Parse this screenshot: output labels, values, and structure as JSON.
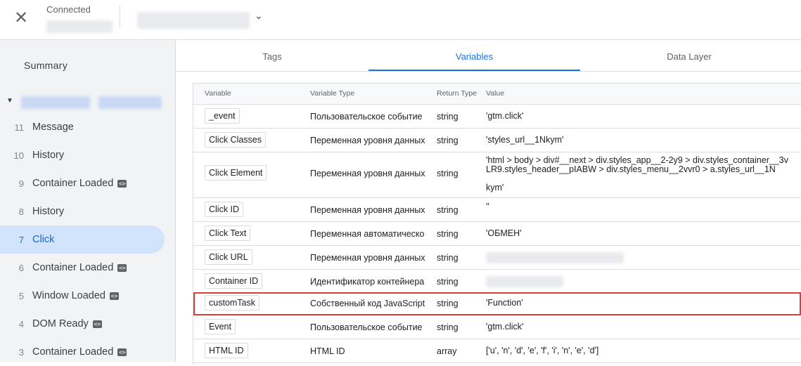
{
  "topbar": {
    "close_icon": "close-icon",
    "status_label": "Connected"
  },
  "sidebar": {
    "summary_label": "Summary",
    "events": [
      {
        "num": "11",
        "name": "Message",
        "tag": false,
        "active": false
      },
      {
        "num": "10",
        "name": "History",
        "tag": false,
        "active": false
      },
      {
        "num": "9",
        "name": "Container Loaded",
        "tag": true,
        "active": false
      },
      {
        "num": "8",
        "name": "History",
        "tag": false,
        "active": false
      },
      {
        "num": "7",
        "name": "Click",
        "tag": false,
        "active": true
      },
      {
        "num": "6",
        "name": "Container Loaded",
        "tag": true,
        "active": false
      },
      {
        "num": "5",
        "name": "Window Loaded",
        "tag": true,
        "active": false
      },
      {
        "num": "4",
        "name": "DOM Ready",
        "tag": true,
        "active": false
      },
      {
        "num": "3",
        "name": "Container Loaded",
        "tag": true,
        "active": false
      }
    ]
  },
  "tabs": [
    {
      "label": "Tags",
      "active": false
    },
    {
      "label": "Variables",
      "active": true
    },
    {
      "label": "Data Layer",
      "active": false
    }
  ],
  "table": {
    "headers": {
      "variable": "Variable",
      "variable_type": "Variable Type",
      "return_type": "Return Type",
      "value": "Value"
    },
    "rows": [
      {
        "variable": "_event",
        "type": "Пользовательское событие",
        "return": "string",
        "value": "'gtm.click'"
      },
      {
        "variable": "Click Classes",
        "type": "Переменная уровня данных",
        "return": "string",
        "value": "'styles_url__1Nkym'"
      },
      {
        "variable": "Click Element",
        "type": "Переменная уровня данных",
        "return": "string",
        "value": "'html > body > div#__next > div.styles_app__2-2y9 > div.styles_container__3vLR9.styles_header__pIABW > div.styles_menu__2vvr0 > a.styles_url__1N",
        "value2": "kym'"
      },
      {
        "variable": "Click ID",
        "type": "Переменная уровня данных",
        "return": "string",
        "value": "''"
      },
      {
        "variable": "Click Text",
        "type": "Переменная автоматическо",
        "return": "string",
        "value": "'ОБМЕН'"
      },
      {
        "variable": "Click URL",
        "type": "Переменная уровня данных",
        "return": "string",
        "value": ""
      },
      {
        "variable": "Container ID",
        "type": "Идентификатор контейнера",
        "return": "string",
        "value": ""
      },
      {
        "variable": "customTask",
        "type": "Собственный код JavaScript",
        "return": "string",
        "value": "'Function'"
      },
      {
        "variable": "Event",
        "type": "Пользовательское событие",
        "return": "string",
        "value": "'gtm.click'"
      },
      {
        "variable": "HTML ID",
        "type": "HTML ID",
        "return": "array",
        "value": "['u', 'n', 'd', 'e', 'f', 'i', 'n', 'e', 'd']"
      }
    ]
  }
}
